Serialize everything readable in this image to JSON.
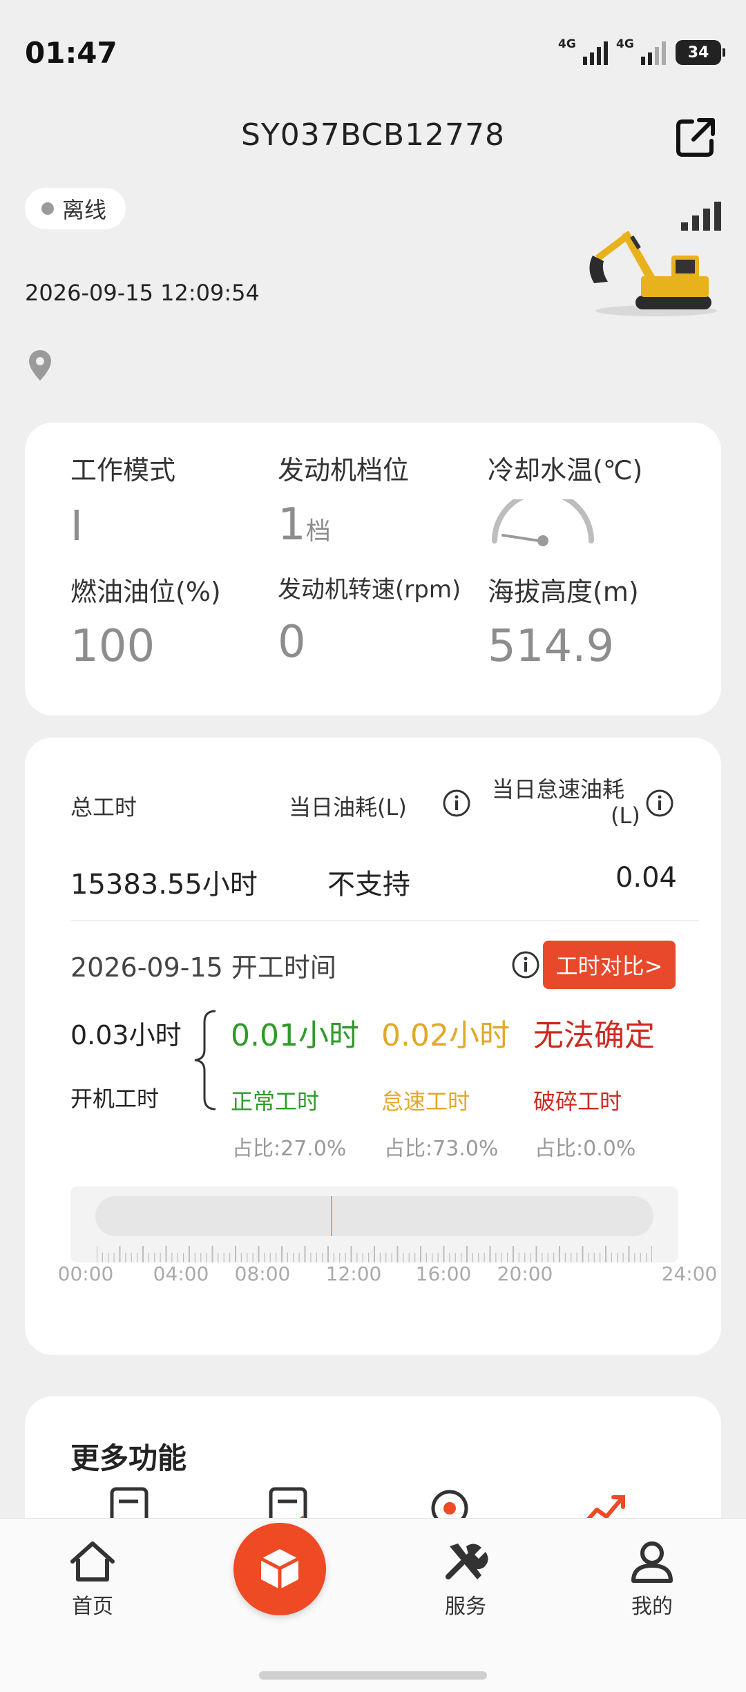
{
  "status_bar": {
    "time": "01:47",
    "net1": "4G",
    "net2": "4G",
    "battery": "34"
  },
  "header": {
    "title": "SY037BCB12778"
  },
  "device": {
    "status": "离线",
    "datetime": "2026-09-15 12:09:54"
  },
  "metrics": {
    "work_mode": {
      "label": "工作模式",
      "value": "I"
    },
    "engine_gear": {
      "label": "发动机档位",
      "value": "1",
      "unit": "档"
    },
    "coolant_temp": {
      "label": "冷却水温(℃)"
    },
    "fuel_level": {
      "label": "燃油油位(%)",
      "value": "100"
    },
    "engine_speed": {
      "label": "发动机转速(rpm)",
      "value": "0"
    },
    "altitude": {
      "label": "海拔高度(m)",
      "value": "514.9"
    }
  },
  "work_stats": {
    "total_hours_label": "总工时",
    "daily_fuel_label": "当日油耗(L)",
    "idle_fuel_label_1": "当日怠速油耗",
    "idle_fuel_label_2": "(L)",
    "total_hours_value": "15383.55小时",
    "daily_fuel_value": "不支持",
    "idle_fuel_value": "0.04",
    "open_time_label": "2026-09-15 开工时间",
    "compare_button": "工时对比>",
    "power_on_hours": "0.03小时",
    "power_on_label": "开机工时",
    "normal": {
      "value": "0.01小时",
      "label": "正常工时",
      "ratio": "占比:27.0%"
    },
    "idle": {
      "value": "0.02小时",
      "label": "怠速工时",
      "ratio": "占比:73.0%"
    },
    "breaking": {
      "value": "无法确定",
      "label": "破碎工时",
      "ratio": "占比:0.0%"
    },
    "timeline_axis": [
      "00:00",
      "04:00",
      "08:00",
      "12:00",
      "16:00",
      "20:00",
      "24:00"
    ]
  },
  "more": {
    "title": "更多功能"
  },
  "nav": {
    "home": "首页",
    "service": "服务",
    "mine": "我的"
  },
  "colors": {
    "accent": "#ee4a24",
    "normal": "#2f9a2a",
    "idle": "#e2a82a",
    "breaking": "#cc2a1f"
  }
}
